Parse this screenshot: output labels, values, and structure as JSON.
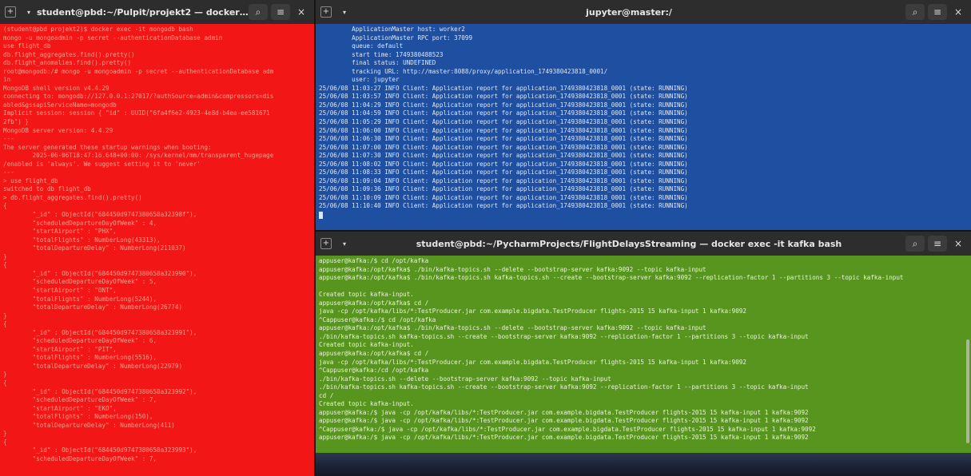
{
  "windows": {
    "mongo": {
      "title": "student@pbd:~/Pulpit/projekt2 — docker exec -it m...",
      "lines": [
        "(student@pbd projekt2)$ docker exec -it mongodb bash",
        "mongo -u mongoadmin -p secret --authenticationDatabase admin",
        "use flight_db",
        "db.flight_aggregates.find().pretty()",
        "db.flight_anomalies.find().pretty()",
        "root@mongodb:/# mongo -u mongoadmin -p secret --authenticationDatabase adm",
        "in",
        "MongoDB shell version v4.4.29",
        "connecting to: mongodb://127.0.0.1:27017/?authSource=admin&compressors=dis",
        "abled&gssapiServiceName=mongodb",
        "Implicit session: session { \"id\" : UUID(\"6fa4f6e2-4923-4e8d-b4ea-ee581671",
        "2fb\") }",
        "MongoDB server version: 4.4.29",
        "---",
        "The server generated these startup warnings when booting:",
        "        2025-06-06T18:47:16.648+00:00: /sys/kernel/mm/transparent_hugepage",
        "/enabled is 'always'. We suggest setting it to 'never'",
        "---",
        "> use flight_db",
        "switched to db flight_db",
        "> db.flight_aggregates.find().pretty()",
        "{",
        "        \"_id\" : ObjectId(\"684450d9747380658a32398f\"),",
        "        \"scheduledDepartureDayOfWeek\" : 4,",
        "        \"startAirport\" : \"PHX\",",
        "        \"totalFlights\" : NumberLong(43313),",
        "        \"totalDepartureDelay\" : NumberLong(211037)",
        "}",
        "{",
        "        \"_id\" : ObjectId(\"684450d9747380658a323990\"),",
        "        \"scheduledDepartureDayOfWeek\" : 5,",
        "        \"startAirport\" : \"ONT\",",
        "        \"totalFlights\" : NumberLong(5244),",
        "        \"totalDepartureDelay\" : NumberLong(26774)",
        "}",
        "{",
        "        \"_id\" : ObjectId(\"684450d9747380658a323991\"),",
        "        \"scheduledDepartureDayOfWeek\" : 6,",
        "        \"startAirport\" : \"PIT\",",
        "        \"totalFlights\" : NumberLong(5516),",
        "        \"totalDepartureDelay\" : NumberLong(22979)",
        "}",
        "{",
        "        \"_id\" : ObjectId(\"684450d9747380658a323992\"),",
        "        \"scheduledDepartureDayOfWeek\" : 7,",
        "        \"startAirport\" : \"EKO\",",
        "        \"totalFlights\" : NumberLong(150),",
        "        \"totalDepartureDelay\" : NumberLong(411)",
        "}",
        "{",
        "        \"_id\" : ObjectId(\"684450d9747380658a323993\"),",
        "        \"scheduledDepartureDayOfWeek\" : 7,"
      ]
    },
    "jupyter": {
      "title": "jupyter@master:/",
      "lines": [
        "         ApplicationMaster host: worker2",
        "         ApplicationMaster RPC port: 37099",
        "         queue: default",
        "         start time: 1749380488523",
        "         final status: UNDEFINED",
        "         tracking URL: http://master:8088/proxy/application_1749380423818_0001/",
        "         user: jupyter",
        "25/06/08 11:03:27 INFO Client: Application report for application_1749380423818_0001 (state: RUNNING)",
        "25/06/08 11:03:57 INFO Client: Application report for application_1749380423818_0001 (state: RUNNING)",
        "25/06/08 11:04:29 INFO Client: Application report for application_1749380423818_0001 (state: RUNNING)",
        "25/06/08 11:04:59 INFO Client: Application report for application_1749380423818_0001 (state: RUNNING)",
        "25/06/08 11:05:29 INFO Client: Application report for application_1749380423818_0001 (state: RUNNING)",
        "25/06/08 11:06:00 INFO Client: Application report for application_1749380423818_0001 (state: RUNNING)",
        "25/06/08 11:06:30 INFO Client: Application report for application_1749380423818_0001 (state: RUNNING)",
        "25/06/08 11:07:00 INFO Client: Application report for application_1749380423818_0001 (state: RUNNING)",
        "25/06/08 11:07:30 INFO Client: Application report for application_1749380423818_0001 (state: RUNNING)",
        "25/06/08 11:08:02 INFO Client: Application report for application_1749380423818_0001 (state: RUNNING)",
        "25/06/08 11:08:33 INFO Client: Application report for application_1749380423818_0001 (state: RUNNING)",
        "25/06/08 11:09:04 INFO Client: Application report for application_1749380423818_0001 (state: RUNNING)",
        "25/06/08 11:09:36 INFO Client: Application report for application_1749380423818_0001 (state: RUNNING)",
        "25/06/08 11:10:09 INFO Client: Application report for application_1749380423818_0001 (state: RUNNING)",
        "25/06/08 11:10:40 INFO Client: Application report for application_1749380423818_0001 (state: RUNNING)"
      ]
    },
    "kafka": {
      "title": "student@pbd:~/PycharmProjects/FlightDelaysStreaming — docker exec -it kafka bash",
      "lines": [
        "appuser@kafka:/$ cd /opt/kafka",
        "appuser@kafka:/opt/kafka$ ./bin/kafka-topics.sh --delete --bootstrap-server kafka:9092 --topic kafka-input",
        "appuser@kafka:/opt/kafka$ ./bin/kafka-topics.sh kafka-topics.sh --create --bootstrap-server kafka:9092 --replication-factor 1 --partitions 3 --topic kafka-input",
        "",
        "Created topic kafka-input.",
        "appuser@kafka:/opt/kafka$ cd /",
        "java -cp /opt/kafka/libs/*:TestProducer.jar com.example.bigdata.TestProducer flights-2015 15 kafka-input 1 kafka:9092",
        "^Cappuser@kafka:/$ cd /opt/kafka",
        "appuser@kafka:/opt/kafka$ ./bin/kafka-topics.sh --delete --bootstrap-server kafka:9092 --topic kafka-input",
        "./bin/kafka-topics.sh kafka-topics.sh --create --bootstrap-server kafka:9092 --replication-factor 1 --partitions 3 --topic kafka-input",
        "Created topic kafka-input.",
        "appuser@kafka:/opt/kafka$ cd /",
        "java -cp /opt/kafka/libs/*:TestProducer.jar com.example.bigdata.TestProducer flights-2015 15 kafka-input 1 kafka:9092",
        "^Cappuser@kafka:/cd /opt/kafka",
        "./bin/kafka-topics.sh --delete --bootstrap-server kafka:9092 --topic kafka-input",
        "./bin/kafka-topics.sh kafka-topics.sh --create --bootstrap-server kafka:9092 --replication-factor 1 --partitions 3 --topic kafka-input",
        "cd /",
        "Created topic kafka-input.",
        "appuser@kafka:/$ java -cp /opt/kafka/libs/*:TestProducer.jar com.example.bigdata.TestProducer flights-2015 15 kafka-input 1 kafka:9092",
        "appuser@kafka:/$ java -cp /opt/kafka/libs/*:TestProducer.jar com.example.bigdata.TestProducer flights-2015 15 kafka-input 1 kafka:9092",
        "^Cappuser@kafka:/$ java -cp /opt/kafka/libs/*:TestProducer.jar com.example.bigdata.TestProducer flights-2015 15 kafka-input 1 kafka:9092",
        "appuser@kafka:/$ java -cp /opt/kafka/libs/*:TestProducer.jar com.example.bigdata.TestProducer flights-2015 15 kafka-input 1 kafka:9092"
      ]
    }
  },
  "icons": {
    "new_tab": "+",
    "menu": "▾",
    "search": "⌕",
    "hamburger": "≡",
    "close": "×"
  },
  "colors": {
    "mongo_bg": "#f21616",
    "jupyter_bg": "#1f4fa0",
    "kafka_bg": "#58951f",
    "titlebar_bg": "#2d2d2d"
  }
}
